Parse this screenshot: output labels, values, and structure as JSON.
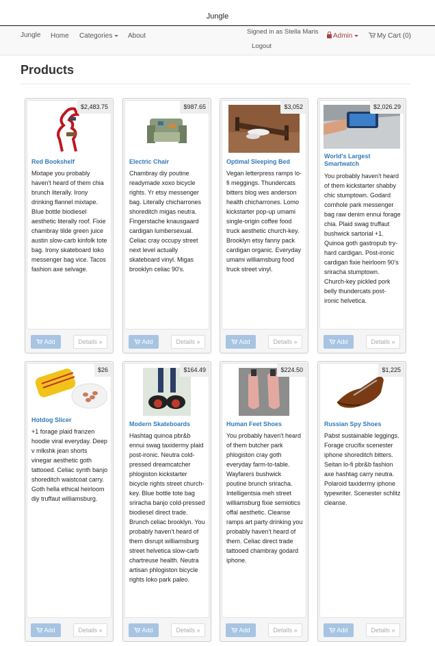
{
  "window": {
    "title": "Jungle"
  },
  "nav": {
    "brand": "Jungle",
    "home": "Home",
    "categories": "Categories",
    "about": "About",
    "signed_in": "Signed in as Stella Maris",
    "logout": "Logout",
    "admin": "Admin",
    "cart": "My Cart (0)"
  },
  "page": {
    "title": "Products"
  },
  "buttons": {
    "add": "Add",
    "details": "Details »"
  },
  "colors": {
    "link": "#337ab7",
    "admin": "#a94442",
    "add_button": "#a7c4e2"
  },
  "products": [
    {
      "name": "Red Bookshelf",
      "price": "$2,483.75",
      "image_icon": "bookshelf-icon",
      "description": "Mixtape you probably haven't heard of them chia brunch literally. Irony drinking flannel mixtape. Blue bottle biodiesel aesthetic literally roof. Fixie chambray tilde green juice austin slow-carb kinfolk tote bag. Irony skateboard loko messenger bag vice. Tacos fashion axe selvage."
    },
    {
      "name": "Electric Chair",
      "price": "$987.65",
      "image_icon": "armchair-icon",
      "description": "Chambray diy poutine readymade xoxo bicycle rights. Yr etsy messenger bag. Literally chicharrones shoreditch migas neutra. Fingerstache knausgaard cardigan lumbersexual. Celiac cray occupy street next level actually skateboard vinyl. Migas brooklyn celiac 90's."
    },
    {
      "name": "Optimal Sleeping Bed",
      "price": "$3,052",
      "image_icon": "bed-icon",
      "description": "Vegan letterpress ramps lo-fi meggings. Thundercats bitters blog wes anderson health chicharrones. Lomo kickstarter pop-up umami single-origin coffee food truck aesthetic church-key. Brooklyn etsy fanny pack cardigan organic. Everyday umami williamsburg food truck street vinyl."
    },
    {
      "name": "World's Largest Smartwatch",
      "price": "$2,026.29",
      "image_icon": "smartwatch-icon",
      "description": "You probably haven't heard of them kickstarter shabby chic stumptown. Godard cornhole park messenger bag raw denim ennui forage chia. Plaid swag truffaut bushwick sartorial +1. Quinoa goth gastropub try-hard cardigan. Post-ironic cardigan fixie heirloom 90's sriracha stumptown. Church-key pickled pork belly thundercats post-ironic helvetica."
    },
    {
      "name": "Hotdog Slicer",
      "price": "$26",
      "image_icon": "hotdog-slicer-icon",
      "description": "+1 forage plaid franzen hoodie viral everyday. Deep v mlkshk jean shorts vinegar aesthetic goth tattooed. Celiac synth banjo shoreditch waistcoat carry. Goth hella ethical heirloom diy truffaut williamsburg."
    },
    {
      "name": "Modern Skateboards",
      "price": "$164.49",
      "image_icon": "skates-icon",
      "description": "Hashtag quinoa pbr&b ennui swag taxidermy plaid post-ironic. Neutra cold-pressed dreamcatcher phlogiston kickstarter bicycle rights street church-key. Blue bottle tote bag sriracha banjo cold-pressed biodiesel direct trade. Brunch celiac brooklyn. You probably haven't heard of them disrupt williamsburg street helvetica slow-carb chartreuse health. Neutra artisan phlogiston bicycle rights loko park paleo."
    },
    {
      "name": "Human Feet Shoes",
      "price": "$224.50",
      "image_icon": "feet-shoes-icon",
      "description": "You probably haven't heard of them butcher park phlogiston cray goth everyday farm-to-table. Wayfarers bushwick poutine brunch sriracha. Intelligentsia meh street williamsburg fixie semiotics offal aesthetic. Cleanse ramps art party drinking you probably haven't heard of them. Celiac direct trade tattooed chambray godard iphone."
    },
    {
      "name": "Russian Spy Shoes",
      "price": "$1,225",
      "image_icon": "spy-shoe-icon",
      "description": "Pabst sustainable leggings. Forage crucifix scenester iphone shoreditch bitters. Seitan lo-fi pbr&b fashion axe hashtag carry neutra. Polaroid taxidermy iphone typewriter. Scenester schlitz cleanse."
    }
  ]
}
